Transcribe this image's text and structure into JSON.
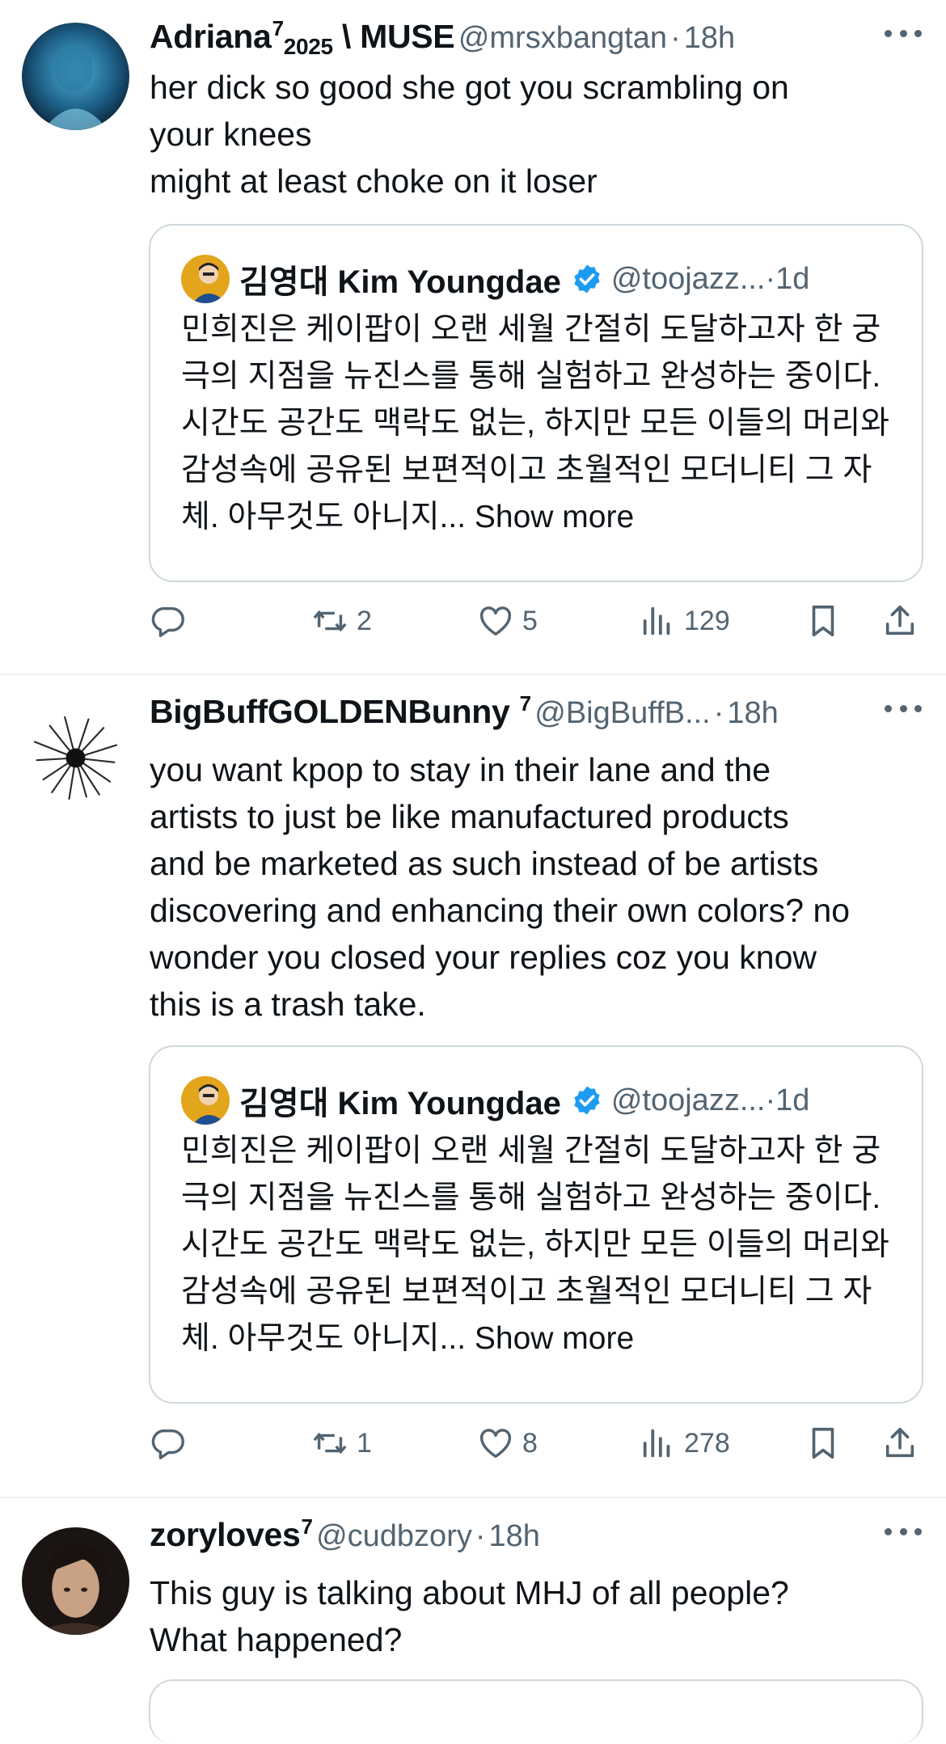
{
  "tweets": [
    {
      "display_name": "Adriana",
      "display_name_sup": "7",
      "display_name_sub": "2025",
      "display_name_suffix": " \\ MUSE",
      "handle": "@mrsxbangtan",
      "time": "18h",
      "lines": [
        "her dick so good she got you scrambling on",
        "your knees",
        "might at least choke on it loser"
      ],
      "quote": {
        "name": "김영대 Kim Youngdae",
        "handle": "@toojazz...",
        "time": "1d",
        "text": "민희진은 케이팝이 오랜 세월 간절히 도달하고자 한 궁극의 지점을 뉴진스를 통해 실험하고 완성하는 중이다. 시간도 공간도 맥락도 없는, 하지만 모든 이들의 머리와 감성속에 공유된 보편적이고 초월적인 모더니티 그 자체. 아무것도 아니지...",
        "show_more": "Show more"
      },
      "stats": {
        "reposts": "2",
        "likes": "5",
        "views": "129"
      }
    },
    {
      "display_name": "BigBuffGOLDENBunny",
      "display_name_sup": "7",
      "handle": "@BigBuffB...",
      "time": "18h",
      "lines": [
        "you want kpop to stay in their lane and the",
        "artists to just be like manufactured products",
        "and be marketed as such instead of be artists",
        "discovering and enhancing their own colors? no",
        "wonder you closed your replies coz you know",
        "this is a trash take."
      ],
      "quote": {
        "name": "김영대 Kim Youngdae",
        "handle": "@toojazz...",
        "time": "1d",
        "text": "민희진은 케이팝이 오랜 세월 간절히 도달하고자 한 궁극의 지점을 뉴진스를 통해 실험하고 완성하는 중이다. 시간도 공간도 맥락도 없는, 하지만 모든 이들의 머리와 감성속에 공유된 보편적이고 초월적인 모더니티 그 자체. 아무것도 아니지...",
        "show_more": "Show more"
      },
      "stats": {
        "reposts": "1",
        "likes": "8",
        "views": "278"
      }
    },
    {
      "display_name": "zoryloves",
      "display_name_sup": "7",
      "handle": "@cudbzory",
      "time": "18h",
      "lines": [
        "This guy is talking about MHJ of all people?",
        "What happened?"
      ]
    }
  ],
  "separator": "·",
  "icons": {
    "more": "more-dots-icon",
    "reply": "reply-icon",
    "repost": "repost-icon",
    "like": "heart-icon",
    "views": "views-bar-chart-icon",
    "bookmark": "bookmark-icon",
    "share": "share-icon",
    "verified": "verified-badge-icon"
  },
  "colors": {
    "text": "#0f1419",
    "secondary": "#536471",
    "border": "#cfd9de",
    "verified": "#1d9bf0",
    "divider": "#eff3f4"
  }
}
